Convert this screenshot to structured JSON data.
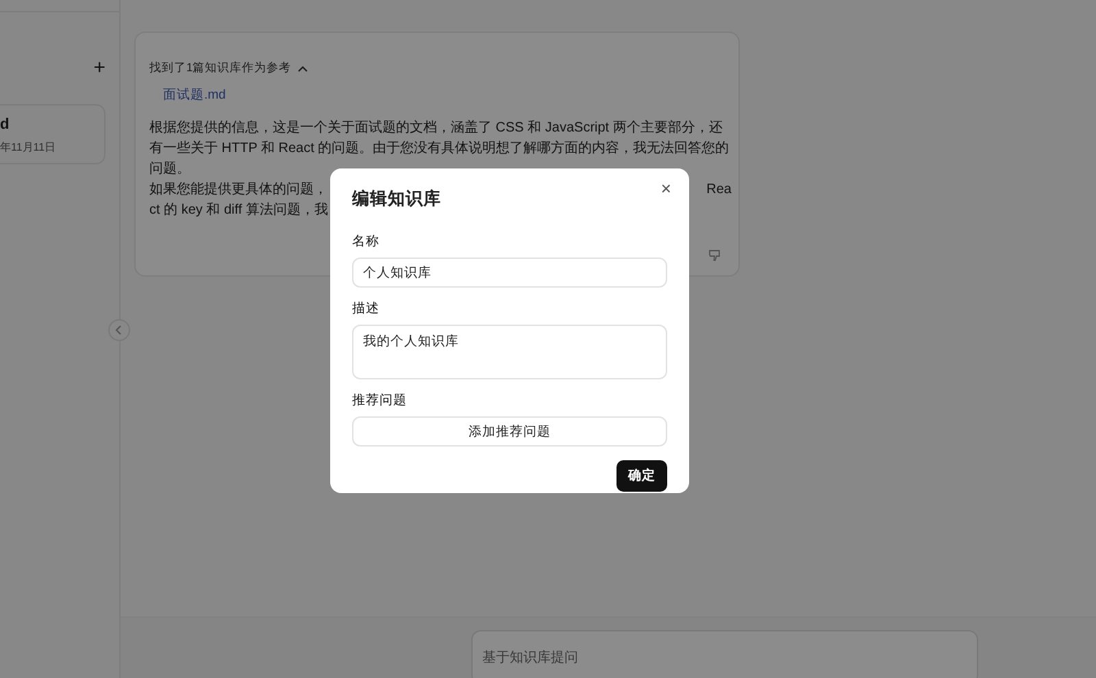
{
  "sidebar": {
    "add_label": "+",
    "item": {
      "title": "d",
      "date": "年11月11日"
    }
  },
  "answer": {
    "reference_title": "找到了1篇知识库作为参考",
    "expanded": true,
    "files": [
      "面试题.md"
    ],
    "paragraph": "根据您提供的信息，这是一个关于面试题的文档，涵盖了 CSS 和 JavaScript 两个主要部分，还有一些关于 HTTP 和 React 的问题。由于您没有具体说明想了解哪方面的内容，我无法回答您的问题。",
    "line_left": "如果您能提供更具体的问题，",
    "line_right": "Rea",
    "line_last": "ct 的 key 和 diff 算法问题，我"
  },
  "dialog": {
    "title": "编辑知识库",
    "close": "×",
    "fields": [
      {
        "kind": "input",
        "label": "名称",
        "value": "个人知识库"
      },
      {
        "kind": "textarea",
        "label": "描述",
        "value": "我的个人知识库"
      },
      {
        "kind": "button",
        "label": "推荐问题",
        "value": "添加推荐问题"
      }
    ],
    "confirm": "确定"
  },
  "ask": {
    "placeholder": "基于知识库提问"
  }
}
